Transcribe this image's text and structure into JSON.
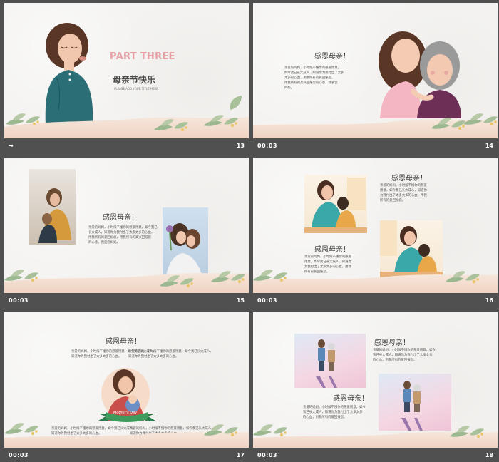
{
  "slides": [
    {
      "time": "→",
      "num": "13",
      "title": "PART THREE",
      "subtitle": "母亲节快乐",
      "small": "PLEASE ADD YOUR TITLE HERE"
    },
    {
      "time": "00:03",
      "num": "14",
      "heading": "感恩母亲！",
      "lines": [
        "亲爱的妈妈，小时候不懂你的慈爱用意，",
        "如今我已长大成人，知道你为我付出了太多",
        "太多的心血，用我所有的爱回报您，",
        "用我所有的高兴回报您的心意，我爱您",
        "妈妈。"
      ]
    },
    {
      "time": "00:03",
      "num": "15",
      "heading": "感恩母亲！",
      "lines": [
        "亲爱的妈妈，小时候不懂你的慈爱用意，如今我已",
        "长大成人，知道你为我付出了太多太多的心血，",
        "用我所有的爱回报您，用我所有的高兴回报您",
        "的心意，我爱您妈妈。"
      ]
    },
    {
      "time": "00:03",
      "num": "16",
      "heading1": "感恩母亲！",
      "heading2": "感恩母亲！",
      "lines1": [
        "亲爱的妈妈，小时候不懂你的慈爱",
        "用意，如今我已长大成人，知道你",
        "为我付出了太多太多的心血，用我",
        "所有的爱回报您。"
      ],
      "lines2": [
        "亲爱的妈妈，小时候不懂你的慈爱",
        "用意，如今我已长大成人，知道你",
        "为我付出了太多太多的心血，用我",
        "所有的爱回报您。"
      ]
    },
    {
      "time": "00:03",
      "num": "17",
      "heading": "感恩母亲！",
      "banner": "Mother's Day",
      "linesL": [
        "亲爱的妈妈，小时候不懂你的慈爱用意，如今我已长大成人，",
        "知道你为我付出了太多太多的心血。"
      ],
      "linesR": [
        "亲爱的妈妈，小时候不懂你的慈爱用意，如今我已长大成人，",
        "知道你为我付出了太多太多的心血。"
      ],
      "linesB1": [
        "亲爱的妈妈，小时候不懂你的慈爱用意，如今我已长大成人，",
        "知道你为我付出了太多太多的心血。"
      ],
      "linesB2": [
        "亲爱的妈妈，小时候不懂你的慈爱用意，如今我已长大成人，",
        "知道你为我付出了太多太多的心血。"
      ]
    },
    {
      "time": "00:03",
      "num": "18",
      "heading1": "感恩母亲！",
      "heading2": "感恩母亲！",
      "lines1": [
        "亲爱的妈妈，小时候不懂你的慈爱用意，如今",
        "我已长大成人，知道你为我付出了太多太多",
        "的心血，用我所有的爱回报您。"
      ],
      "lines2": [
        "亲爱的妈妈，小时候不懂你的慈爱用意，如今",
        "我已长大成人，知道你为我付出了太多太多",
        "的心血，用我所有的爱回报您。"
      ]
    }
  ],
  "colors": {
    "accent": "#e6a0a6",
    "caption_bg": "#505050",
    "leaf": "#8fb08a"
  },
  "icons": [
    "transition-star-icon"
  ]
}
